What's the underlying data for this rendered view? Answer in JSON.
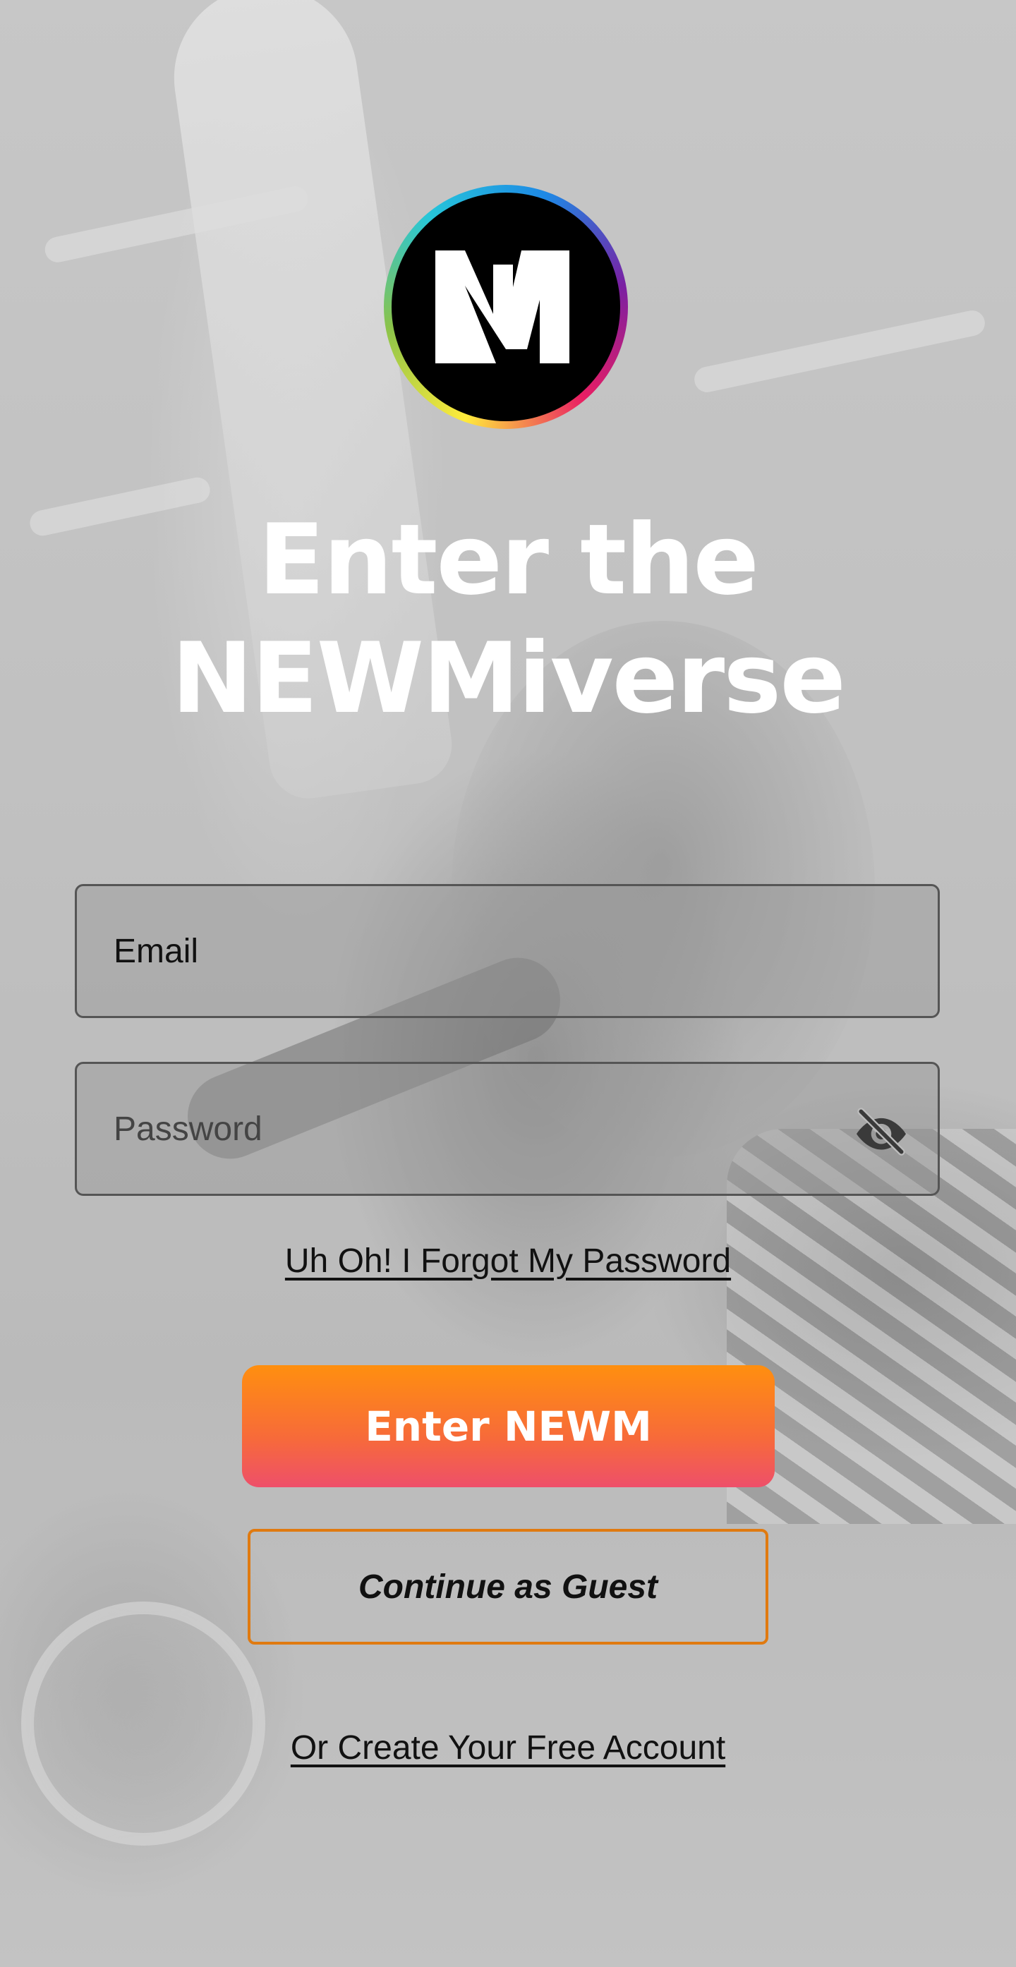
{
  "logo": {
    "icon": "newm-logo-icon",
    "text": "NM"
  },
  "headline": {
    "line1": "Enter the",
    "line2": "NEWMiverse"
  },
  "email": {
    "placeholder": "Email",
    "value": ""
  },
  "password": {
    "placeholder": "Password",
    "value": "",
    "toggle_icon": "eye-off-icon"
  },
  "forgot_password": {
    "label": "Uh Oh! I Forgot My Password"
  },
  "primary_button": {
    "label": "Enter NEWM"
  },
  "guest_button": {
    "label": "Continue as Guest"
  },
  "create_account": {
    "label": "Or Create Your Free Account"
  },
  "colors": {
    "primary_gradient_top": "#ff8f0f",
    "primary_gradient_bottom": "#ee4f6a",
    "guest_border": "#e07a10",
    "headline_text": "#ffffff"
  }
}
